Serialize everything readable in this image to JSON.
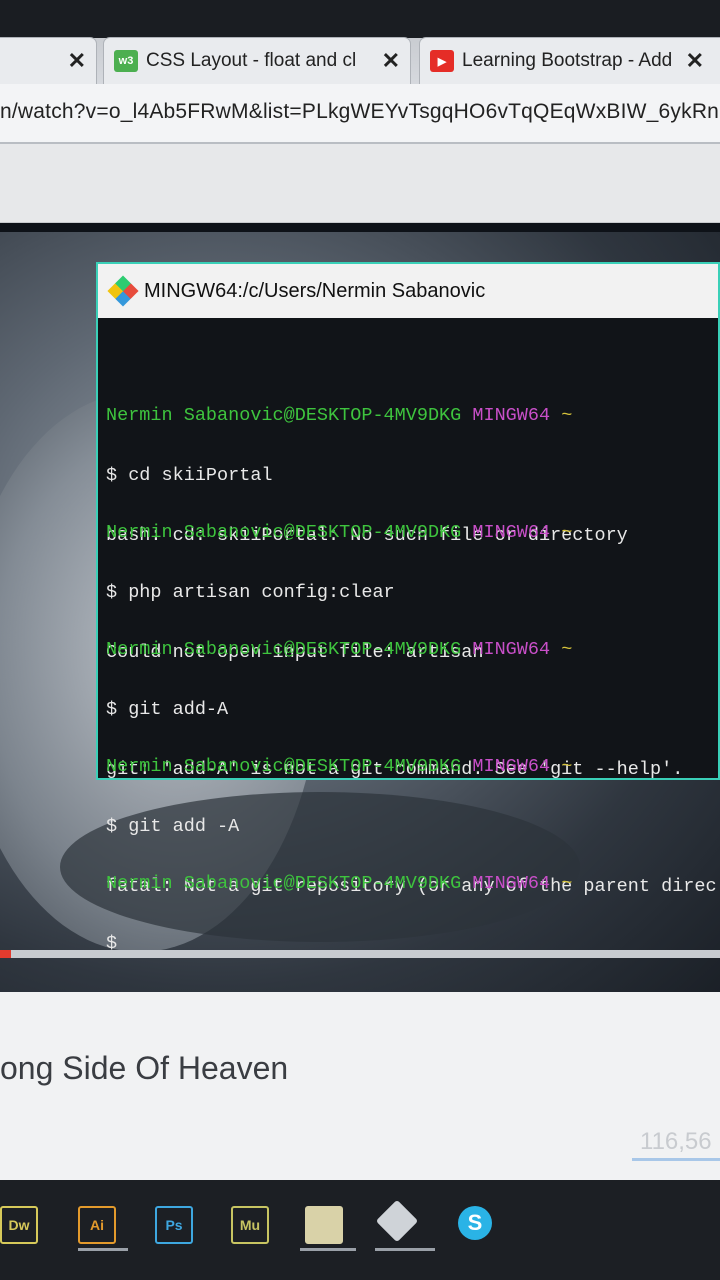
{
  "browser": {
    "tabs": [
      {
        "label": "",
        "close": "✕"
      },
      {
        "label": "CSS Layout - float and cl",
        "favicon": "w3",
        "close": "✕"
      },
      {
        "label": "Learning Bootstrap - Add",
        "favicon": "▶",
        "close": "✕"
      }
    ],
    "url": "n/watch?v=o_l4Ab5FRwM&list=PLkgWEYvTsgqHO6vTqQEqWxBIW_6ykRn"
  },
  "terminal": {
    "title": "MINGW64:/c/Users/Nermin Sabanovic",
    "blocks": [
      {
        "user": "Nermin Sabanovic@DESKTOP-4MV9DKG",
        "shell": "MINGW64",
        "path": "~",
        "cmd": "$ cd skiiPortal",
        "out": "bash: cd: skiiPortal: No such file or directory"
      },
      {
        "user": "Nermin Sabanovic@DESKTOP-4MV9DKG",
        "shell": "MINGW64",
        "path": "~",
        "cmd": "$ php artisan config:clear",
        "out": "Could not open input file: artisan"
      },
      {
        "user": "Nermin Sabanovic@DESKTOP-4MV9DKG",
        "shell": "MINGW64",
        "path": "~",
        "cmd": "$ git add-A",
        "out": "git: 'add-A' is not a git command. See 'git --help'."
      },
      {
        "user": "Nermin Sabanovic@DESKTOP-4MV9DKG",
        "shell": "MINGW64",
        "path": "~",
        "cmd": "$ git add -A",
        "out": "fatal: Not a git repository (or any of the parent direc"
      },
      {
        "user": "Nermin Sabanovic@DESKTOP-4MV9DKG",
        "shell": "MINGW64",
        "path": "~",
        "cmd": "$",
        "out": ""
      }
    ]
  },
  "video": {
    "title": "ong Side Of Heaven",
    "views": "116,56",
    "progress": 0.015
  },
  "taskbar": {
    "apps": [
      {
        "label": "Dw",
        "color": "#d6c95a"
      },
      {
        "label": "Ai",
        "color": "#e39a2c"
      },
      {
        "label": "Ps",
        "color": "#3ea7e0"
      },
      {
        "label": "Mu",
        "color": "#c7c462"
      },
      {
        "label": "",
        "color": "#d9d2a8"
      },
      {
        "label": "",
        "color": "#cfd3d8"
      },
      {
        "label": "S",
        "color": "#2ab3e6"
      }
    ]
  }
}
